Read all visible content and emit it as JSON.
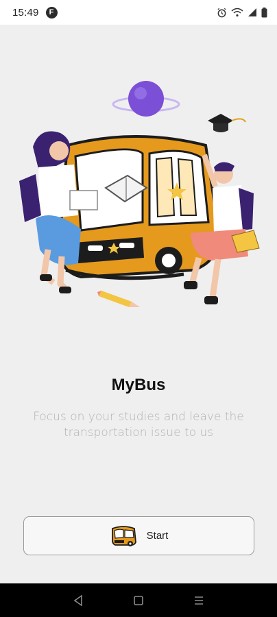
{
  "status_bar": {
    "time": "15:49",
    "app_badge": "F",
    "icons": [
      "alarm-icon",
      "wifi-icon",
      "signal-icon",
      "battery-icon"
    ]
  },
  "app": {
    "title": "MyBus",
    "subtitle": "Focus on your studies and leave the transportation issue to us",
    "illustration_name": "students-bus-illustration",
    "start_button": {
      "label": "Start",
      "icon": "bus-icon"
    }
  },
  "nav_bar": {
    "buttons": [
      "back-icon",
      "home-icon",
      "recents-icon"
    ]
  },
  "colors": {
    "background": "#efefef",
    "bus_orange": "#e59a1d",
    "planet_purple": "#7b4fd6"
  }
}
